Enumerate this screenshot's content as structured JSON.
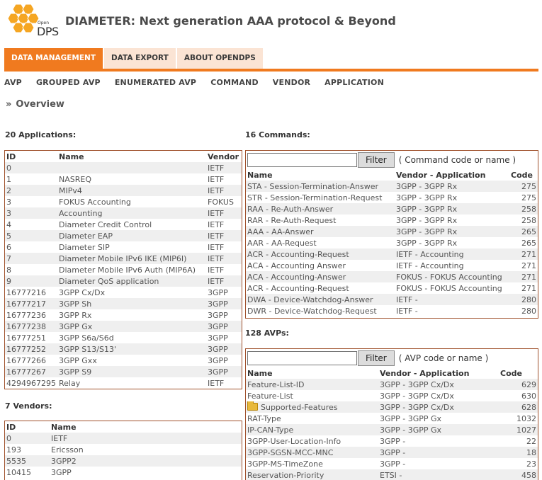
{
  "header": {
    "logo_open": "Open",
    "logo_dps": "DPS",
    "title": "DIAMETER: Next generation AAA protocol & Beyond"
  },
  "colors": {
    "accent": "#f07a1f",
    "tab_inactive": "#fbe4d4",
    "border": "#a0522d",
    "row_alt": "#efefef"
  },
  "main_nav": [
    {
      "label": "DATA MANAGEMENT",
      "active": true
    },
    {
      "label": "DATA EXPORT",
      "active": false
    },
    {
      "label": "ABOUT OPENDPS",
      "active": false
    }
  ],
  "sub_nav": [
    "AVP",
    "GROUPED AVP",
    "ENUMERATED AVP",
    "COMMAND",
    "VENDOR",
    "APPLICATION"
  ],
  "page_title": {
    "marker": "»",
    "text": "Overview"
  },
  "applications": {
    "title": "20 Applications:",
    "headers": [
      "ID",
      "Name",
      "Vendor"
    ],
    "rows": [
      [
        "0",
        "",
        "IETF"
      ],
      [
        "1",
        "NASREQ",
        "IETF"
      ],
      [
        "2",
        "MIPv4",
        "IETF"
      ],
      [
        "3",
        "FOKUS Accounting",
        "FOKUS"
      ],
      [
        "3",
        "Accounting",
        "IETF"
      ],
      [
        "4",
        "Diameter Credit Control",
        "IETF"
      ],
      [
        "5",
        "Diameter EAP",
        "IETF"
      ],
      [
        "6",
        "Diameter SIP",
        "IETF"
      ],
      [
        "7",
        "Diameter Mobile IPv6 IKE (MIP6I)",
        "IETF"
      ],
      [
        "8",
        "Diameter Mobile IPv6 Auth (MIP6A)",
        "IETF"
      ],
      [
        "9",
        "Diameter QoS application",
        "IETF"
      ],
      [
        "16777216",
        "3GPP Cx/Dx",
        "3GPP"
      ],
      [
        "16777217",
        "3GPP Sh",
        "3GPP"
      ],
      [
        "16777236",
        "3GPP Rx",
        "3GPP"
      ],
      [
        "16777238",
        "3GPP Gx",
        "3GPP"
      ],
      [
        "16777251",
        "3GPP S6a/S6d",
        "3GPP"
      ],
      [
        "16777252",
        "3GPP S13/S13'",
        "3GPP"
      ],
      [
        "16777266",
        "3GPP Gxx",
        "3GPP"
      ],
      [
        "16777267",
        "3GPP S9",
        "3GPP"
      ],
      [
        "4294967295",
        "Relay",
        "IETF"
      ]
    ]
  },
  "vendors": {
    "title": "7 Vendors:",
    "headers": [
      "ID",
      "Name"
    ],
    "rows": [
      [
        "0",
        "IETF"
      ],
      [
        "193",
        "Ericsson"
      ],
      [
        "5535",
        "3GPP2"
      ],
      [
        "10415",
        "3GPP"
      ]
    ]
  },
  "commands": {
    "title": "16 Commands:",
    "filter_value": "",
    "filter_button": "Filter",
    "filter_hint": "( Command code or name )",
    "headers": [
      "Name",
      "Vendor - Application",
      "Code"
    ],
    "rows": [
      [
        "STA - Session-Termination-Answer",
        "3GPP - 3GPP Rx",
        "275"
      ],
      [
        "STR - Session-Termination-Request",
        "3GPP - 3GPP Rx",
        "275"
      ],
      [
        "RAA - Re-Auth-Answer",
        "3GPP - 3GPP Rx",
        "258"
      ],
      [
        "RAR - Re-Auth-Request",
        "3GPP - 3GPP Rx",
        "258"
      ],
      [
        "AAA - AA-Answer",
        "3GPP - 3GPP Rx",
        "265"
      ],
      [
        "AAR - AA-Request",
        "3GPP - 3GPP Rx",
        "265"
      ],
      [
        "ACR - Accounting-Request",
        "IETF - Accounting",
        "271"
      ],
      [
        "ACA - Accounting Answer",
        "IETF - Accounting",
        "271"
      ],
      [
        "ACA - Accounting-Answer",
        "FOKUS - FOKUS Accounting",
        "271"
      ],
      [
        "ACR - Accounting-Request",
        "FOKUS - FOKUS Accounting",
        "271"
      ],
      [
        "DWA - Device-Watchdog-Answer",
        "IETF -",
        "280"
      ],
      [
        "DWR - Device-Watchdog-Request",
        "IETF -",
        "280"
      ]
    ]
  },
  "avps": {
    "title": "128 AVPs:",
    "filter_value": "",
    "filter_button": "Filter",
    "filter_hint": "( AVP code or name )",
    "headers": [
      "Name",
      "Vendor - Application",
      "Code"
    ],
    "rows": [
      {
        "name": "Feature-List-ID",
        "vendor": "3GPP - 3GPP Cx/Dx",
        "code": "629",
        "icon": ""
      },
      {
        "name": "Feature-List",
        "vendor": "3GPP - 3GPP Cx/Dx",
        "code": "630",
        "icon": ""
      },
      {
        "name": "Supported-Features",
        "vendor": "3GPP - 3GPP Cx/Dx",
        "code": "628",
        "icon": "folder-icon"
      },
      {
        "name": "RAT-Type",
        "vendor": "3GPP - 3GPP Gx",
        "code": "1032",
        "icon": ""
      },
      {
        "name": "IP-CAN-Type",
        "vendor": "3GPP - 3GPP Gx",
        "code": "1027",
        "icon": ""
      },
      {
        "name": "3GPP-User-Location-Info",
        "vendor": "3GPP -",
        "code": "22",
        "icon": ""
      },
      {
        "name": "3GPP-SGSN-MCC-MNC",
        "vendor": "3GPP -",
        "code": "18",
        "icon": ""
      },
      {
        "name": "3GPP-MS-TimeZone",
        "vendor": "3GPP -",
        "code": "23",
        "icon": ""
      },
      {
        "name": "Reservation-Priority",
        "vendor": "ETSI -",
        "code": "458",
        "icon": ""
      }
    ]
  }
}
